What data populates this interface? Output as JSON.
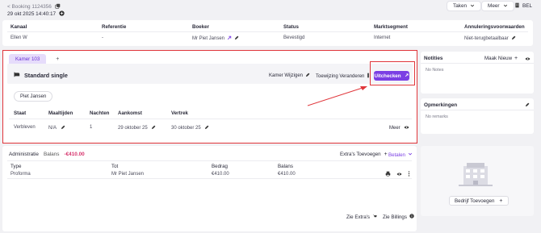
{
  "header": {
    "back_label": "< Booking 1124356",
    "datetime": "29 okt 2025 14:40:17",
    "tasks_label": "Taken",
    "more_label": "Meer",
    "lang_label": "BEL"
  },
  "booking_table": {
    "headers": [
      "Kanaal",
      "Referentie",
      "Boeker",
      "Status",
      "Marktsegment",
      "Annuleringsvoorwaarden"
    ],
    "row": [
      "Ellen W",
      "-",
      "Mr Piet Jansen",
      "Bevestigd",
      "Internet",
      "Niet-terugbetaalbaar"
    ]
  },
  "room": {
    "tab_label": "Kamer 103",
    "add_tab": "+",
    "room_type": "Standard single",
    "change_room_label": "Kamer Wijzigen",
    "change_assignment_label": "Toewijzing Veranderen",
    "checkout_label": "Uitchecken",
    "guest_chip": "Piet Jansen",
    "stay_headers": [
      "Staat",
      "Maaltijden",
      "Nachten",
      "Aankomst",
      "Vertrek"
    ],
    "stay_row": [
      "Verbleven",
      "N/A",
      "1",
      "29 oktober 25",
      "30 oktober 25"
    ],
    "more_label": "Meer"
  },
  "admin": {
    "title": "Administratie",
    "balance_label": "Balans",
    "balance_value": "-€410.00",
    "extras_add_label": "Extra's Toevoegen",
    "pay_label": "Betalen",
    "headers": [
      "Type",
      "Tot",
      "Bedrag",
      "Balans"
    ],
    "row": [
      "Proforma",
      "Mr Piet Jansen",
      "€410.00",
      "€410.00"
    ],
    "see_extras": "Zie Extra's",
    "see_billings": "Zie Billings"
  },
  "notes": {
    "title": "Notities",
    "new_label": "Maak Nieuw",
    "empty": "No Notes"
  },
  "remarks": {
    "title": "Opmerkingen",
    "empty": "No remarks"
  },
  "company": {
    "add_label": "Bedrijf Toevoegen"
  },
  "colors": {
    "accent": "#7b3fe4",
    "negative": "#d6336c",
    "annotation": "#e0353a",
    "tab_bg": "#e6dcfb"
  }
}
